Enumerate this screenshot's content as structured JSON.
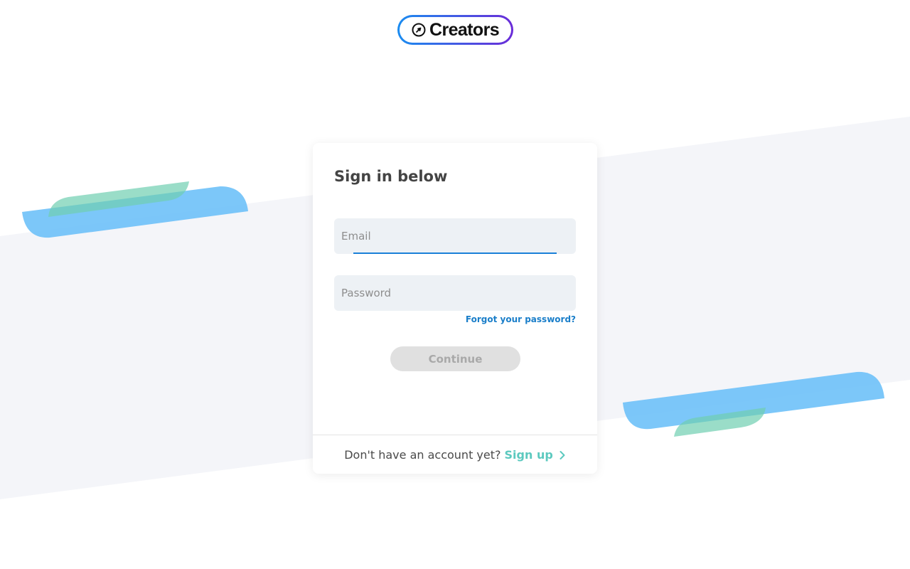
{
  "brand": {
    "name": "Creators",
    "gradient_start": "#1a8cf0",
    "gradient_end": "#6a2bd8"
  },
  "card": {
    "title": "Sign in below"
  },
  "email": {
    "placeholder": "Email",
    "value": ""
  },
  "password": {
    "placeholder": "Password",
    "value": ""
  },
  "forgot_link": "Forgot your password?",
  "continue_button": "Continue",
  "footer": {
    "prompt": "Don't have an account yet?",
    "signup_label": "Sign up"
  },
  "colors": {
    "accent_blue": "#1a80d8",
    "signup_teal": "#5cc9bf",
    "band": "#f4f5f9",
    "blob_blue": "#6ec1f8",
    "blob_green": "#8fd9c0"
  }
}
